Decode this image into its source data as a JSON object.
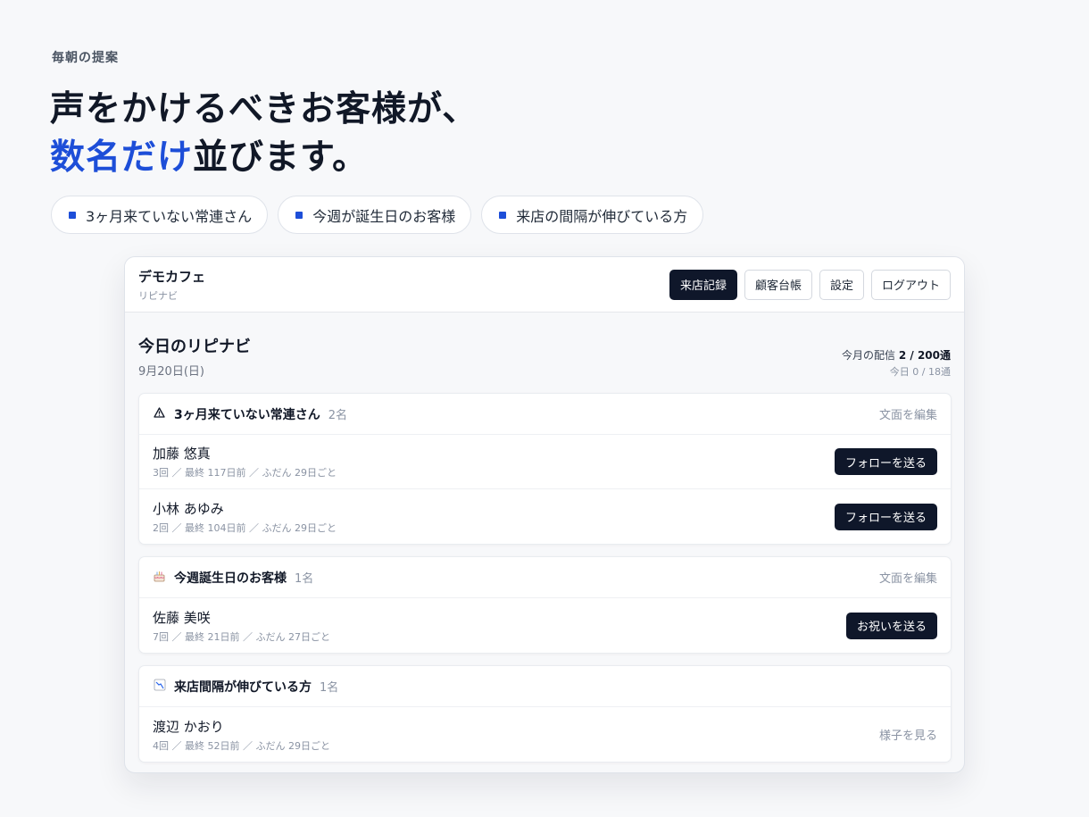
{
  "hero": {
    "eyebrow": "毎朝の提案",
    "headline_line1": "声をかけるべきお客様が、",
    "headline_accent": "数名だけ",
    "headline_rest": "並びます。"
  },
  "chips": [
    {
      "label": "3ヶ月来ていない常連さん"
    },
    {
      "label": "今週が誕生日のお客様"
    },
    {
      "label": "来店の間隔が伸びている方"
    }
  ],
  "app": {
    "shop_name": "デモカフェ",
    "shop_sub": "リピナビ",
    "nav": {
      "visits": "来店記録",
      "customers": "顧客台帳",
      "settings": "設定",
      "logout": "ログアウト"
    },
    "page_title": "今日のリピナビ",
    "date": "9月20日(日)",
    "quota": {
      "label": "今月の配信",
      "value": "2 / 200通",
      "today": "今日 0 / 18通"
    },
    "sections": [
      {
        "icon": "warning-icon",
        "title": "3ヶ月来ていない常連さん",
        "count": "2名",
        "edit_label": "文面を編集",
        "customers": [
          {
            "name": "加藤 悠真",
            "meta": "3回 ／ 最終 117日前 ／ ふだん 29日ごと",
            "action": "フォローを送る"
          },
          {
            "name": "小林 あゆみ",
            "meta": "2回 ／ 最終 104日前 ／ ふだん 29日ごと",
            "action": "フォローを送る"
          }
        ]
      },
      {
        "icon": "birthday-cake-icon",
        "title": "今週誕生日のお客様",
        "count": "1名",
        "edit_label": "文面を編集",
        "customers": [
          {
            "name": "佐藤 美咲",
            "meta": "7回 ／ 最終 21日前 ／ ふだん 27日ごと",
            "action": "お祝いを送る"
          }
        ]
      },
      {
        "icon": "trending-down-icon",
        "title": "来店間隔が伸びている方",
        "count": "1名",
        "customers": [
          {
            "name": "渡辺 かおり",
            "meta": "4回 ／ 最終 52日前 ／ ふだん 29日ごと",
            "action": "様子を見る"
          }
        ]
      }
    ]
  },
  "colors": {
    "accent": "#1d4ed8",
    "primary_button": "#0f172a",
    "background": "#f7f8fa"
  }
}
